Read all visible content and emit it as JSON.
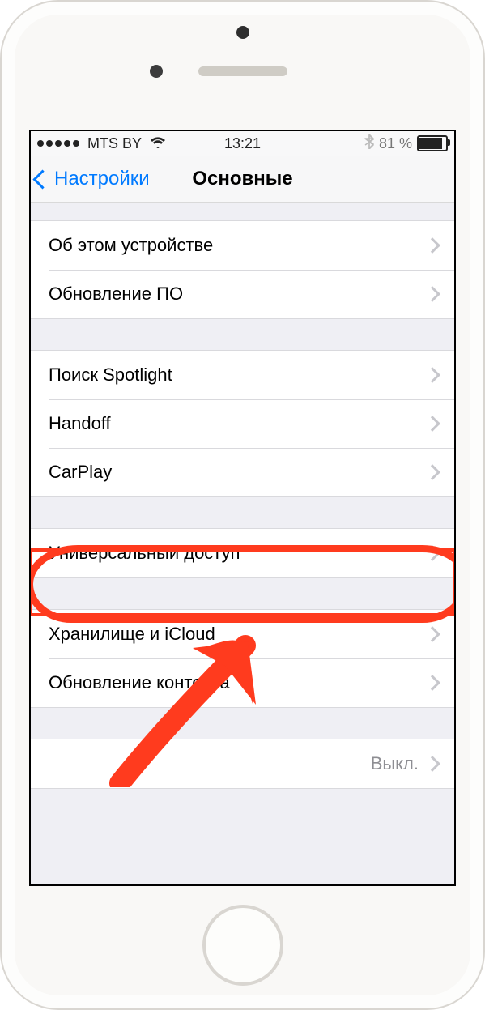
{
  "status": {
    "carrier": "MTS BY",
    "time": "13:21",
    "battery_percent": "81 %"
  },
  "nav": {
    "back": "Настройки",
    "title": "Основные"
  },
  "groups": [
    {
      "items": [
        {
          "label": "Об этом устройстве"
        },
        {
          "label": "Обновление ПО"
        }
      ]
    },
    {
      "items": [
        {
          "label": "Поиск Spotlight"
        },
        {
          "label": "Handoff"
        },
        {
          "label": "CarPlay"
        }
      ]
    },
    {
      "items": [
        {
          "label": "Универсальный доступ"
        }
      ]
    },
    {
      "items": [
        {
          "label": "Хранилище и iCloud"
        },
        {
          "label": "Обновление контента"
        }
      ]
    },
    {
      "items": [
        {
          "label": "",
          "value": "Выкл."
        }
      ]
    }
  ],
  "annotation": {
    "highlighted_item": "Универсальный доступ"
  }
}
